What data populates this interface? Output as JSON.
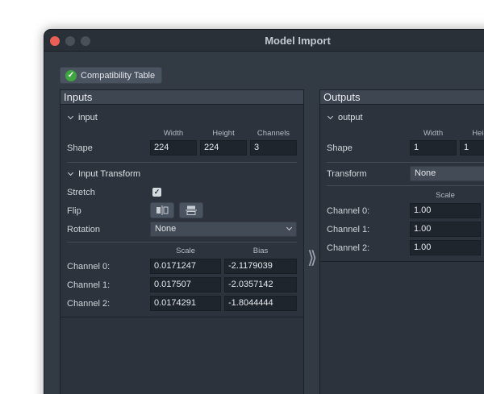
{
  "window": {
    "title": "Model Import"
  },
  "compat_button": {
    "label": "Compatibility Table",
    "icon": "check-circle-icon",
    "icon_color": "#3ea540"
  },
  "inputs": {
    "header": "Inputs",
    "section_title": "input",
    "columns": [
      "Width",
      "Height",
      "Channels"
    ],
    "shape_label": "Shape",
    "shape": [
      "224",
      "224",
      "3"
    ],
    "transform_title": "Input Transform",
    "stretch_label": "Stretch",
    "stretch_checked": true,
    "flip_label": "Flip",
    "rotation_label": "Rotation",
    "rotation_value": "None",
    "scale_header": "Scale",
    "bias_header": "Bias",
    "channels": [
      {
        "label": "Channel 0:",
        "scale": "0.0171247",
        "bias": "-2.1179039"
      },
      {
        "label": "Channel 1:",
        "scale": "0.017507",
        "bias": "-2.0357142"
      },
      {
        "label": "Channel 2:",
        "scale": "0.0174291",
        "bias": "-1.8044444"
      }
    ]
  },
  "outputs": {
    "header": "Outputs",
    "section_title": "output",
    "columns": [
      "Width",
      "Height"
    ],
    "shape_label": "Shape",
    "shape": [
      "1",
      "1"
    ],
    "transform_label": "Transform",
    "transform_value": "None",
    "scale_header": "Scale",
    "channels": [
      {
        "label": "Channel 0:",
        "scale": "1.00"
      },
      {
        "label": "Channel 1:",
        "scale": "1.00"
      },
      {
        "label": "Channel 2:",
        "scale": "1.00"
      }
    ]
  },
  "separator_icon": "double-chevron-right-icon"
}
